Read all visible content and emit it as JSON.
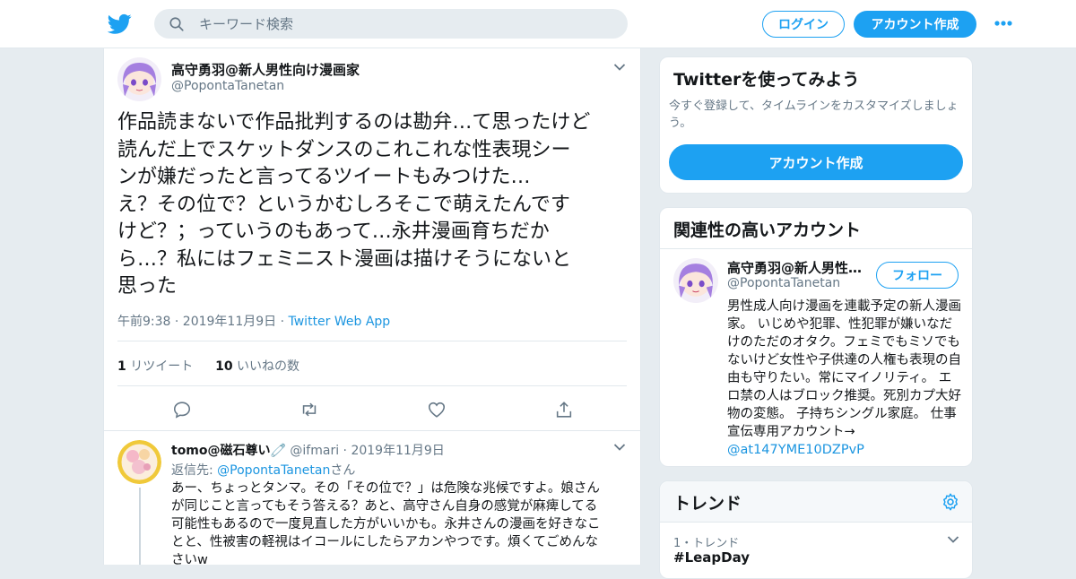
{
  "header": {
    "search_placeholder": "キーワード検索",
    "login_label": "ログイン",
    "signup_label": "アカウント作成"
  },
  "tweet": {
    "display_name": "高守勇羽@新人男性向け漫画家",
    "handle": "@PopontaTanetan",
    "text": "作品読まないで作品批判するのは勘弁…て思ったけど\n読んだ上でスケットダンスのこれこれな性表現シー\nンが嫌だったと言ってるツイートもみつけた…\nえ？その位で？というかむしろそこで萌えたんです\nけど？；っていうのもあって…永井漫画育ちだか\nら…？私にはフェミニスト漫画は描けそうにないと\n思った",
    "time": "午前9:38 · 2019年11月9日 · ",
    "source": "Twitter Web App",
    "retweet_count": "1",
    "retweet_label": " リツイート",
    "like_count": "10",
    "like_label": " いいねの数"
  },
  "reply": {
    "display_name": "tomo@磁石尊い🧷",
    "handle": " @ifmari",
    "date": " · 2019年11月9日",
    "replying_prefix": "返信先: ",
    "replying_to": "@PopontaTanetan",
    "replying_suffix": "さん",
    "text": "あー、ちょっとタンマ。その「その位で？」は危険な兆候ですよ。娘さん\nが同じこと言ってもそう答える？あと、高守さん自身の感覚が麻痺してる\n可能性もあるので一度見直した方がいいかも。永井さんの漫画を好きなこ\nとと、性被害の軽視はイコールにしたらアカンやつです。煩くてごめんな\nさいw"
  },
  "sidebar": {
    "promo": {
      "title": "Twitterを使ってみよう",
      "description": "今すぐ登録して、タイムラインをカスタマイズしましょう。",
      "button": "アカウント作成"
    },
    "related": {
      "title": "関連性の高いアカウント",
      "name": "高守勇羽@新人男性向け漫画家",
      "handle": "@PopontaTanetan",
      "follow_label": "フォロー",
      "bio": "男性成人向け漫画を連載予定の新人漫画家。 いじめや犯罪、性犯罪が嫌いなだけのただのオタク。フェミでもミソでもないけど女性や子供達の人権も表現の自由も守りたい。常にマイノリティ。 エロ禁の人はブロック推奨。死別カプ大好物の変態。 子持ちシングル家庭。 仕事宣伝専用アカウント→",
      "bio_link": "@at147YME10DZPvP"
    },
    "trends": {
      "title": "トレンド",
      "rank": "1・トレンド",
      "name": "#LeapDay"
    }
  },
  "colors": {
    "brand": "#1da1f2",
    "link": "#1b95e0",
    "muted": "#657786"
  }
}
